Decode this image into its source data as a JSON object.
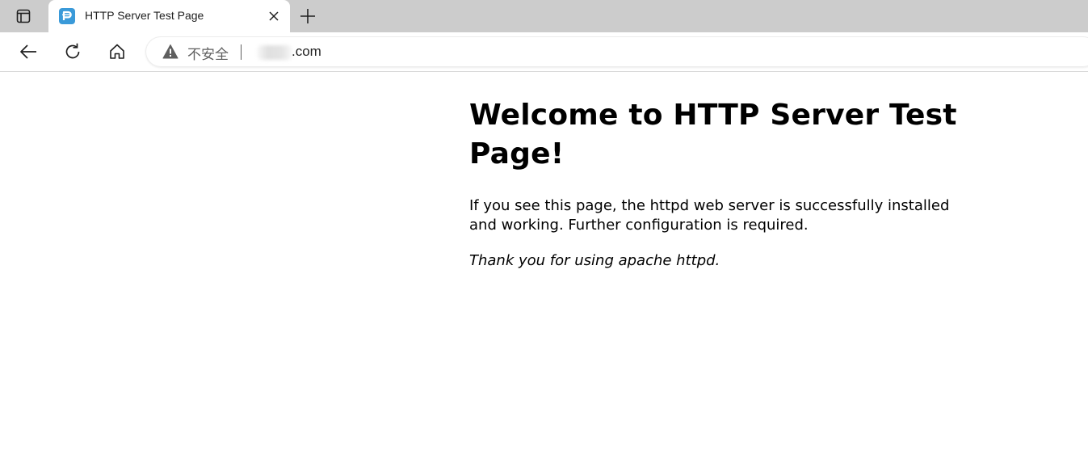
{
  "browser": {
    "tab": {
      "title": "HTTP Server Test Page",
      "favicon": "p-favicon-icon"
    },
    "toolbar": {
      "security_label": "不安全",
      "url_visible": ".com"
    },
    "icons": {
      "tab_actions": "tab-actions-icon",
      "close": "close-icon",
      "new_tab": "plus-icon",
      "back": "back-arrow-icon",
      "reload": "reload-icon",
      "home": "home-icon",
      "warning": "warning-triangle-icon"
    },
    "colors": {
      "tabstrip": "#cccccc",
      "favicon_accent": "#3a9ad9"
    }
  },
  "page": {
    "heading": "Welcome to HTTP Server Test Page!",
    "paragraph": "If you see this page, the httpd web server is successfully installed and working. Further configuration is required.",
    "thanks": "Thank you for using apache httpd."
  }
}
